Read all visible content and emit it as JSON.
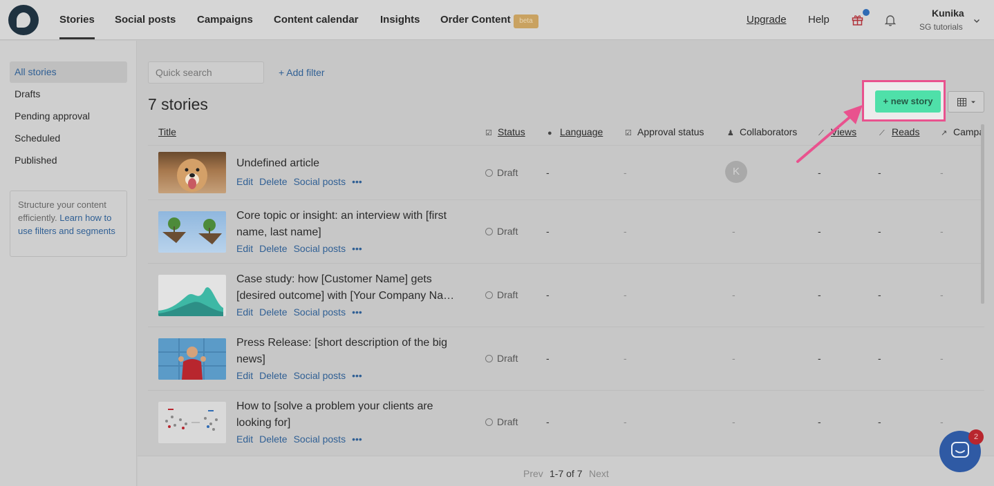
{
  "nav": {
    "items": [
      "Stories",
      "Social posts",
      "Campaigns",
      "Content calendar",
      "Insights",
      "Order Content"
    ],
    "beta_badge": "beta",
    "upgrade": "Upgrade",
    "help": "Help",
    "user_name": "Kunika",
    "user_workspace": "SG tutorials",
    "icons": {
      "logo": "storychief-logo",
      "gift": "gift-icon",
      "bell": "bell-icon",
      "chevron": "chevron-down-icon"
    },
    "colors": {
      "gift_dot": "#2f6bb4",
      "beta": "#c9a261"
    }
  },
  "sidebar": {
    "items": [
      "All stories",
      "Drafts",
      "Pending approval",
      "Scheduled",
      "Published"
    ],
    "help_text": "Structure your content efficiently.",
    "help_link": "Learn how to use filters and segments"
  },
  "toolbar": {
    "search_placeholder": "Quick search",
    "add_filter": "+ Add filter",
    "count_title": "7 stories",
    "new_story": "+ new story",
    "colors": {
      "new_story": "#4fe0a9",
      "highlight": "#e9528e"
    }
  },
  "table": {
    "columns": [
      "Title",
      "Status",
      "Language",
      "Approval status",
      "Collaborators",
      "Views",
      "Reads",
      "Campa"
    ],
    "actions": [
      "Edit",
      "Delete",
      "Social posts",
      "•••"
    ],
    "rows": [
      {
        "title": "Undefined article",
        "status": "Draft",
        "language": "-",
        "approval": "-",
        "collaborator": "K",
        "views": "-",
        "reads": "-",
        "campaigns": "-"
      },
      {
        "title": "Core topic or insight: an interview with [first name, last name]",
        "status": "Draft",
        "language": "-",
        "approval": "-",
        "collaborator": "-",
        "views": "-",
        "reads": "-",
        "campaigns": "-"
      },
      {
        "title": "Case study: how [Customer Name] gets [desired outcome] with [Your Company Na…",
        "status": "Draft",
        "language": "-",
        "approval": "-",
        "collaborator": "-",
        "views": "-",
        "reads": "-",
        "campaigns": "-"
      },
      {
        "title": "Press Release: [short description of the big news]",
        "status": "Draft",
        "language": "-",
        "approval": "-",
        "collaborator": "-",
        "views": "-",
        "reads": "-",
        "campaigns": "-"
      },
      {
        "title": "How to [solve a problem your clients are looking for]",
        "status": "Draft",
        "language": "-",
        "approval": "-",
        "collaborator": "-",
        "views": "-",
        "reads": "-",
        "campaigns": "-"
      }
    ]
  },
  "pagination": {
    "prev": "Prev",
    "range": "1-7 of 7",
    "next": "Next"
  },
  "chat": {
    "badge": "2"
  }
}
